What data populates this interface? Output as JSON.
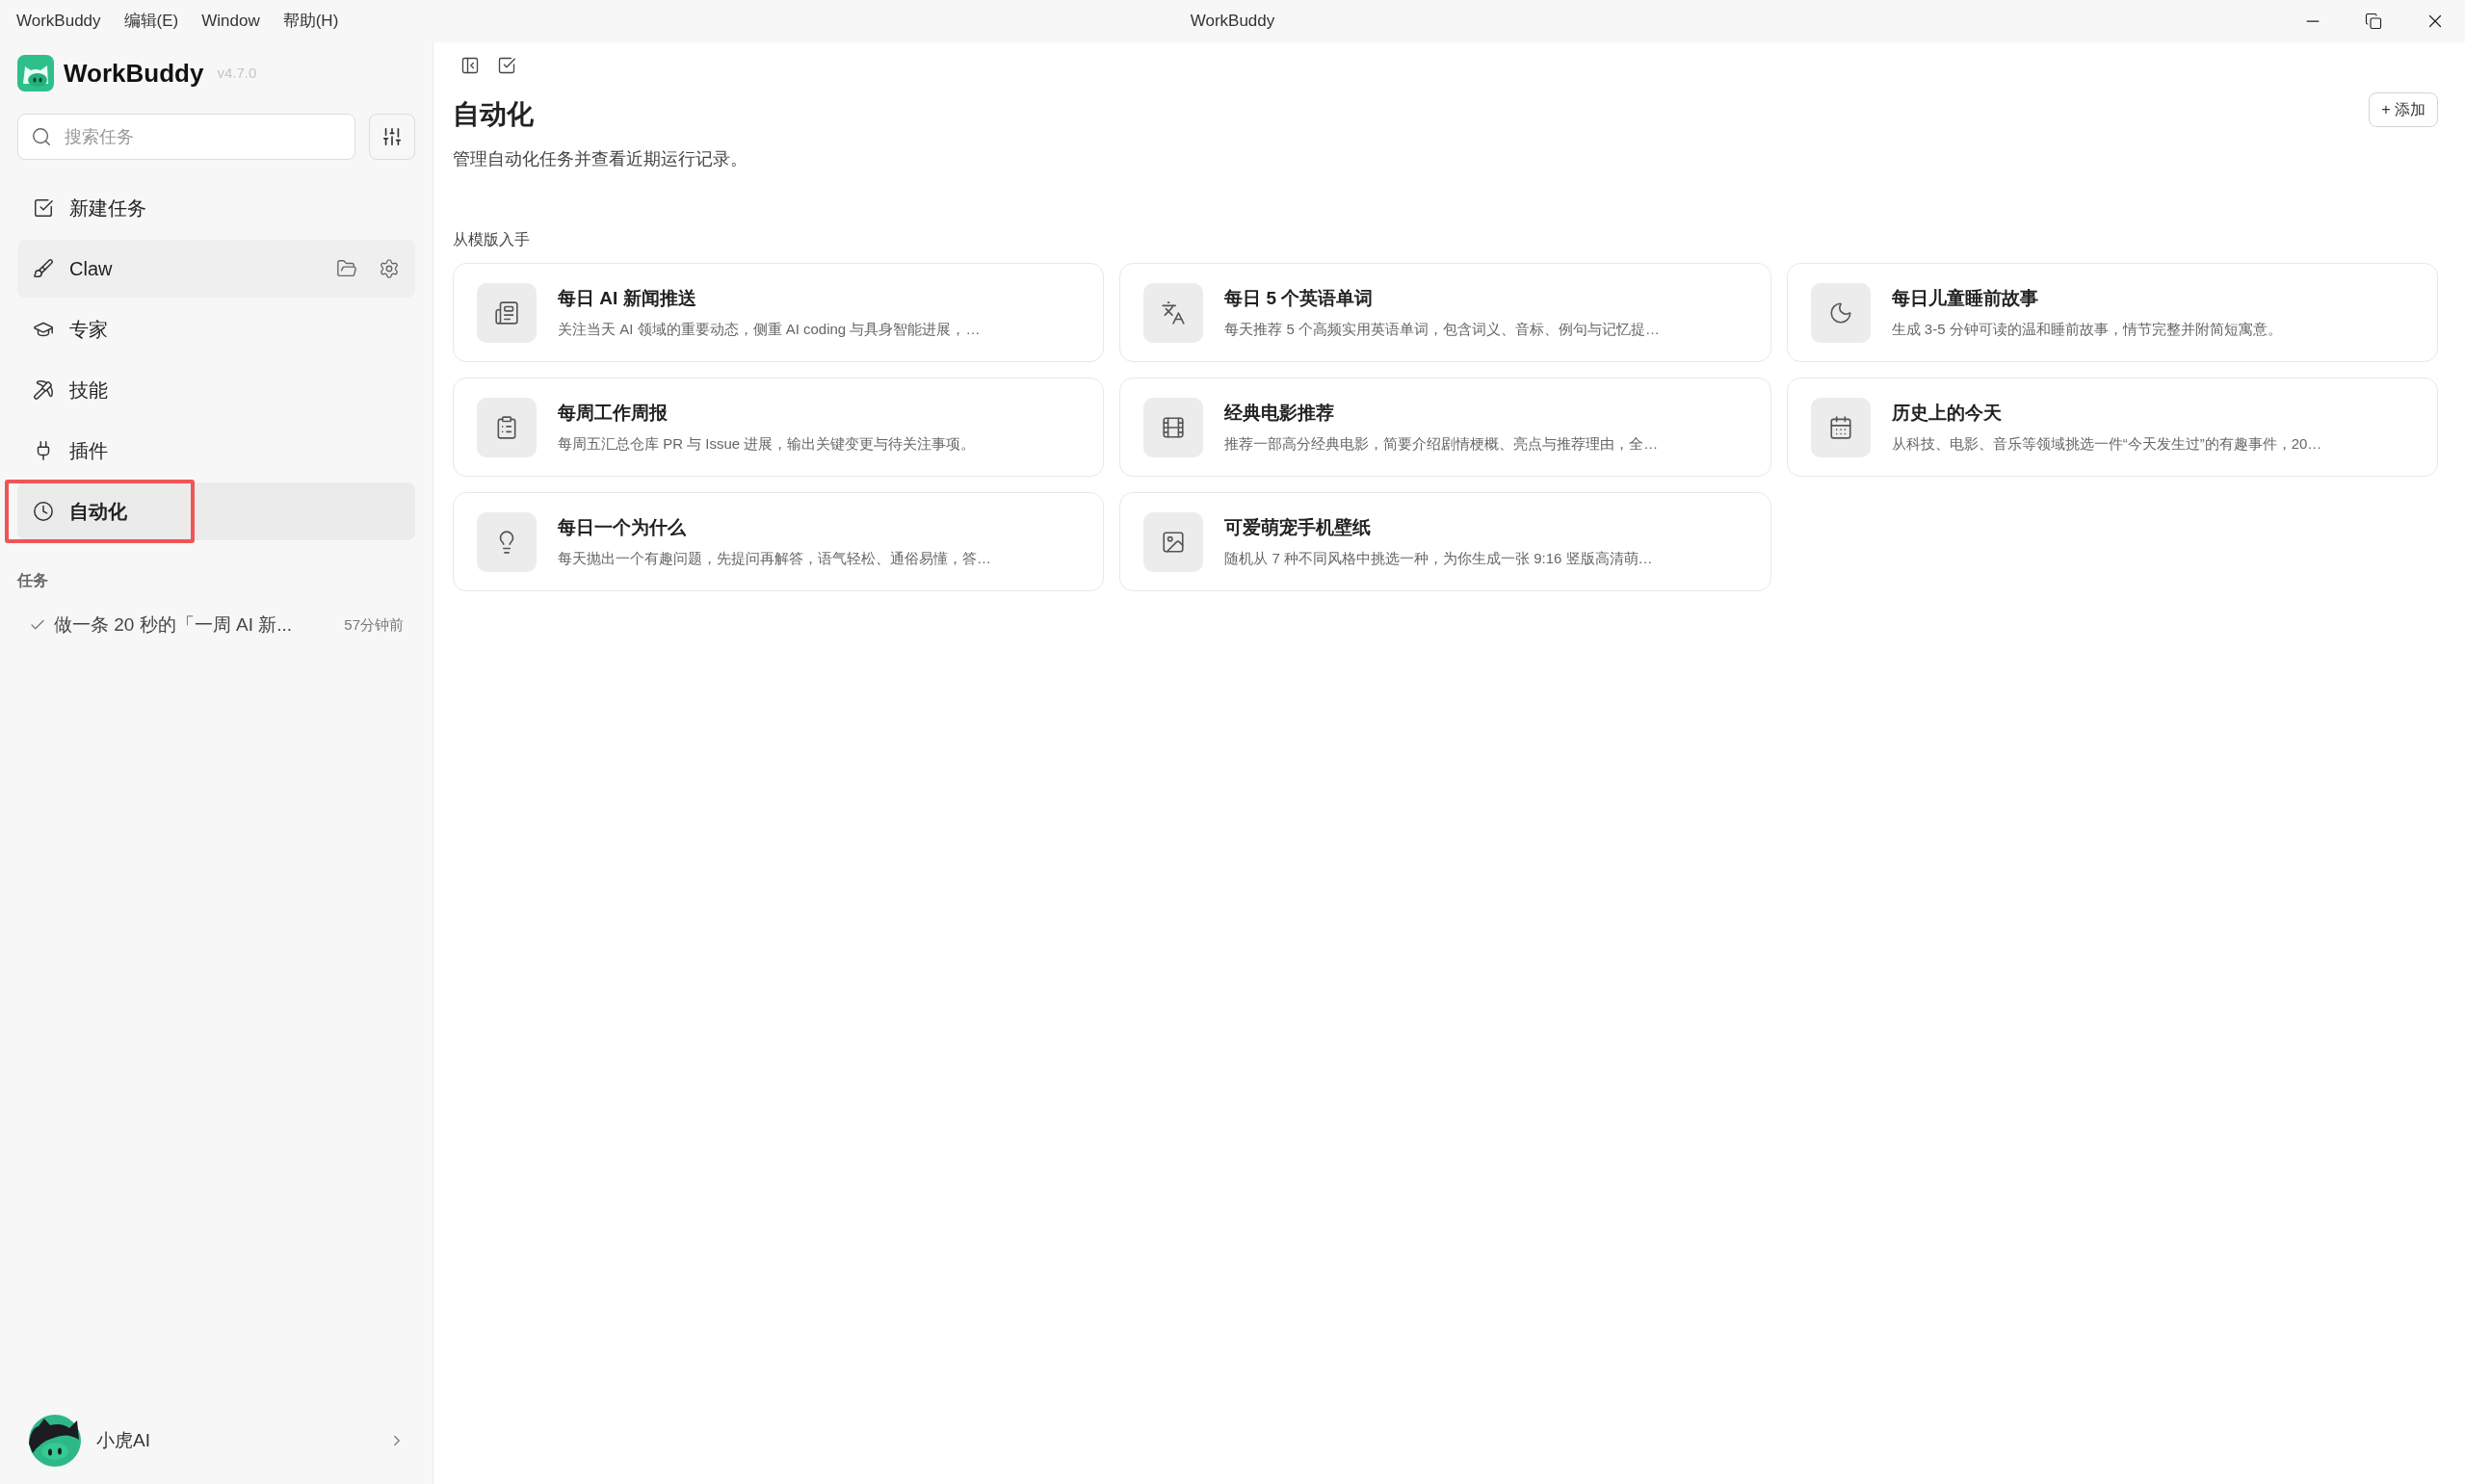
{
  "window": {
    "title": "WorkBuddy",
    "menu": [
      "WorkBuddy",
      "编辑(E)",
      "Window",
      "帮助(H)"
    ]
  },
  "sidebar": {
    "app_name": "WorkBuddy",
    "version": "v4.7.0",
    "search": {
      "placeholder": "搜索任务"
    },
    "nav": [
      {
        "label": "新建任务",
        "kind": "plain",
        "selected": false,
        "annotated": false
      },
      {
        "label": "Claw",
        "kind": "workspace",
        "selected": false,
        "annotated": false
      },
      {
        "label": "专家",
        "kind": "plain",
        "selected": false,
        "annotated": false
      },
      {
        "label": "技能",
        "kind": "plain",
        "selected": false,
        "annotated": false
      },
      {
        "label": "插件",
        "kind": "plain",
        "selected": false,
        "annotated": false
      },
      {
        "label": "自动化",
        "kind": "plain",
        "selected": true,
        "annotated": true
      }
    ],
    "tasks_heading": "任务",
    "tasks": [
      {
        "title": "做一条 20 秒的「一周 AI 新...",
        "time": "57分钟前",
        "done": true
      }
    ],
    "user": {
      "name": "小虎AI"
    }
  },
  "main": {
    "title": "自动化",
    "subtitle": "管理自动化任务并查看近期运行记录。",
    "add_button": "+ 添加",
    "section_label": "从模版入手",
    "templates": [
      {
        "title": "每日 AI 新闻推送",
        "description": "关注当天 AI 领域的重要动态，侧重 AI coding 与具身智能进展，…"
      },
      {
        "title": "每日 5 个英语单词",
        "description": "每天推荐 5 个高频实用英语单词，包含词义、音标、例句与记忆提…"
      },
      {
        "title": "每日儿童睡前故事",
        "description": "生成 3-5 分钟可读的温和睡前故事，情节完整并附简短寓意。"
      },
      {
        "title": "每周工作周报",
        "description": "每周五汇总仓库 PR 与 Issue 进展，输出关键变更与待关注事项。"
      },
      {
        "title": "经典电影推荐",
        "description": "推荐一部高分经典电影，简要介绍剧情梗概、亮点与推荐理由，全…"
      },
      {
        "title": "历史上的今天",
        "description": "从科技、电影、音乐等领域挑选一件“今天发生过”的有趣事件，20…"
      },
      {
        "title": "每日一个为什么",
        "description": "每天抛出一个有趣问题，先提问再解答，语气轻松、通俗易懂，答…"
      },
      {
        "title": "可爱萌宠手机壁纸",
        "description": "随机从 7 种不同风格中挑选一种，为你生成一张 9:16 竖版高清萌…"
      }
    ]
  }
}
